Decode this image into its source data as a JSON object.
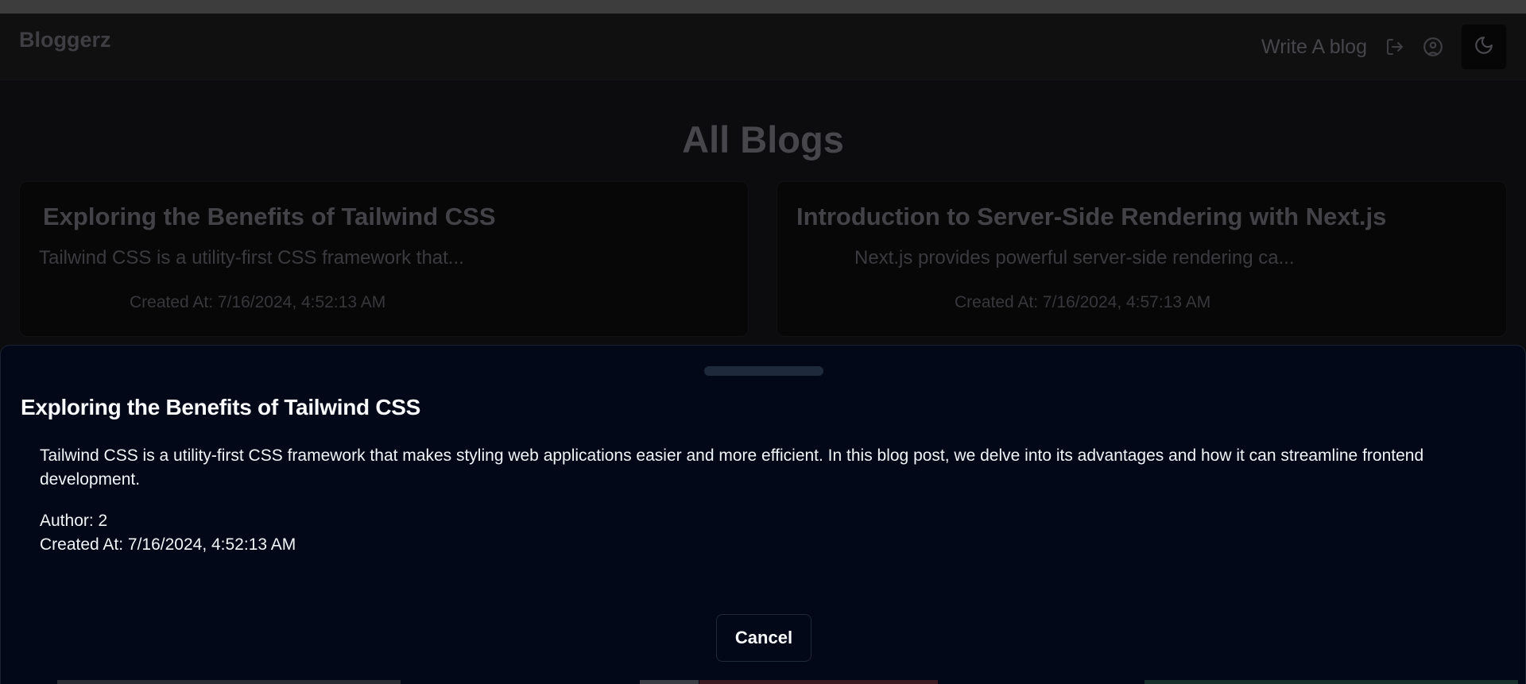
{
  "colors": {
    "drawer_bg": "#020817",
    "overlay_text": "#46464b",
    "drawer_text": "#f8fafc"
  },
  "header": {
    "brand": "Bloggerz",
    "write_link": "Write A blog",
    "icons": [
      "logout-icon",
      "user-circle-icon",
      "moon-icon"
    ]
  },
  "main": {
    "title": "All Blogs",
    "cards": [
      {
        "title": "Exploring the Benefits of Tailwind CSS",
        "excerpt": "Tailwind CSS is a utility-first CSS framework that...",
        "created": "Created At: 7/16/2024, 4:52:13 AM"
      },
      {
        "title": "Introduction to Server-Side Rendering with Next.js",
        "excerpt": "Next.js provides powerful server-side rendering ca...",
        "created": "Created At: 7/16/2024, 4:57:13 AM"
      }
    ]
  },
  "drawer": {
    "title": "Exploring the Benefits of Tailwind CSS",
    "description": "Tailwind CSS is a utility-first CSS framework that makes styling web applications easier and more efficient. In this blog post, we delve into its advantages and how it can streamline frontend development.",
    "author": "Author: 2",
    "created": "Created At: 7/16/2024, 4:52:13 AM",
    "cancel_label": "Cancel"
  }
}
